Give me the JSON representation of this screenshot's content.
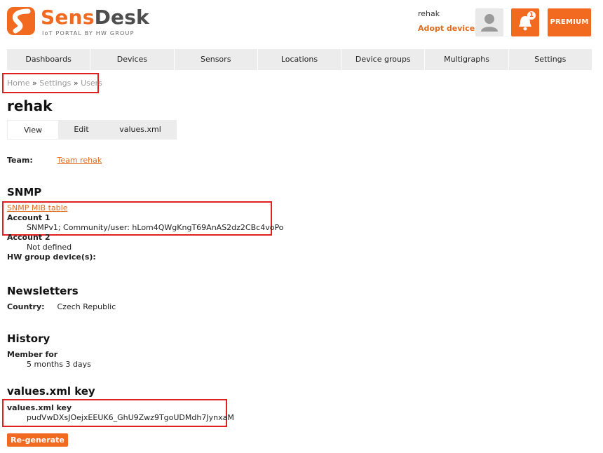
{
  "brand": {
    "name_a": "Sens",
    "name_b": "Desk",
    "subtitle": "IoT PORTAL BY HW GROUP"
  },
  "user": {
    "name": "rehak",
    "adopt_label": "Adopt device"
  },
  "notifications": {
    "count": "1"
  },
  "premium_label": "PREMIUM",
  "nav": [
    "Dashboards",
    "Devices",
    "Sensors",
    "Locations",
    "Device groups",
    "Multigraphs",
    "Settings"
  ],
  "breadcrumb": {
    "home": "Home",
    "sep": "»",
    "settings": "Settings",
    "users": "Users"
  },
  "page_title": "rehak",
  "tabs": {
    "view": "View",
    "edit": "Edit",
    "xml": "values.xml"
  },
  "team": {
    "label": "Team:",
    "value": "Team rehak"
  },
  "snmp": {
    "heading": "SNMP",
    "mib_link": "SNMP MIB table",
    "account1_label": "Account 1",
    "account1_value": "SNMPv1; Community/user: hLom4QWgKngT69AnAS2dz2CBc4voPo",
    "account2_label": "Account 2",
    "account2_value": "Not defined",
    "devices_label": "HW group device(s):"
  },
  "newsletters": {
    "heading": "Newsletters",
    "country_label": "Country:",
    "country_value": "Czech Republic"
  },
  "history": {
    "heading": "History",
    "member_label": "Member for",
    "member_value": "5 months 3 days"
  },
  "xmlkey": {
    "heading": "values.xml key",
    "label": "values.xml key",
    "value": "pudVwDXsJOejxEEUK6_GhU9Zwz9TgoUDMdh7JynxaM",
    "button": "Re-generate"
  },
  "colors": {
    "accent": "#f26a1f",
    "nav_bg": "#ececec",
    "highlight": "#e02020"
  }
}
